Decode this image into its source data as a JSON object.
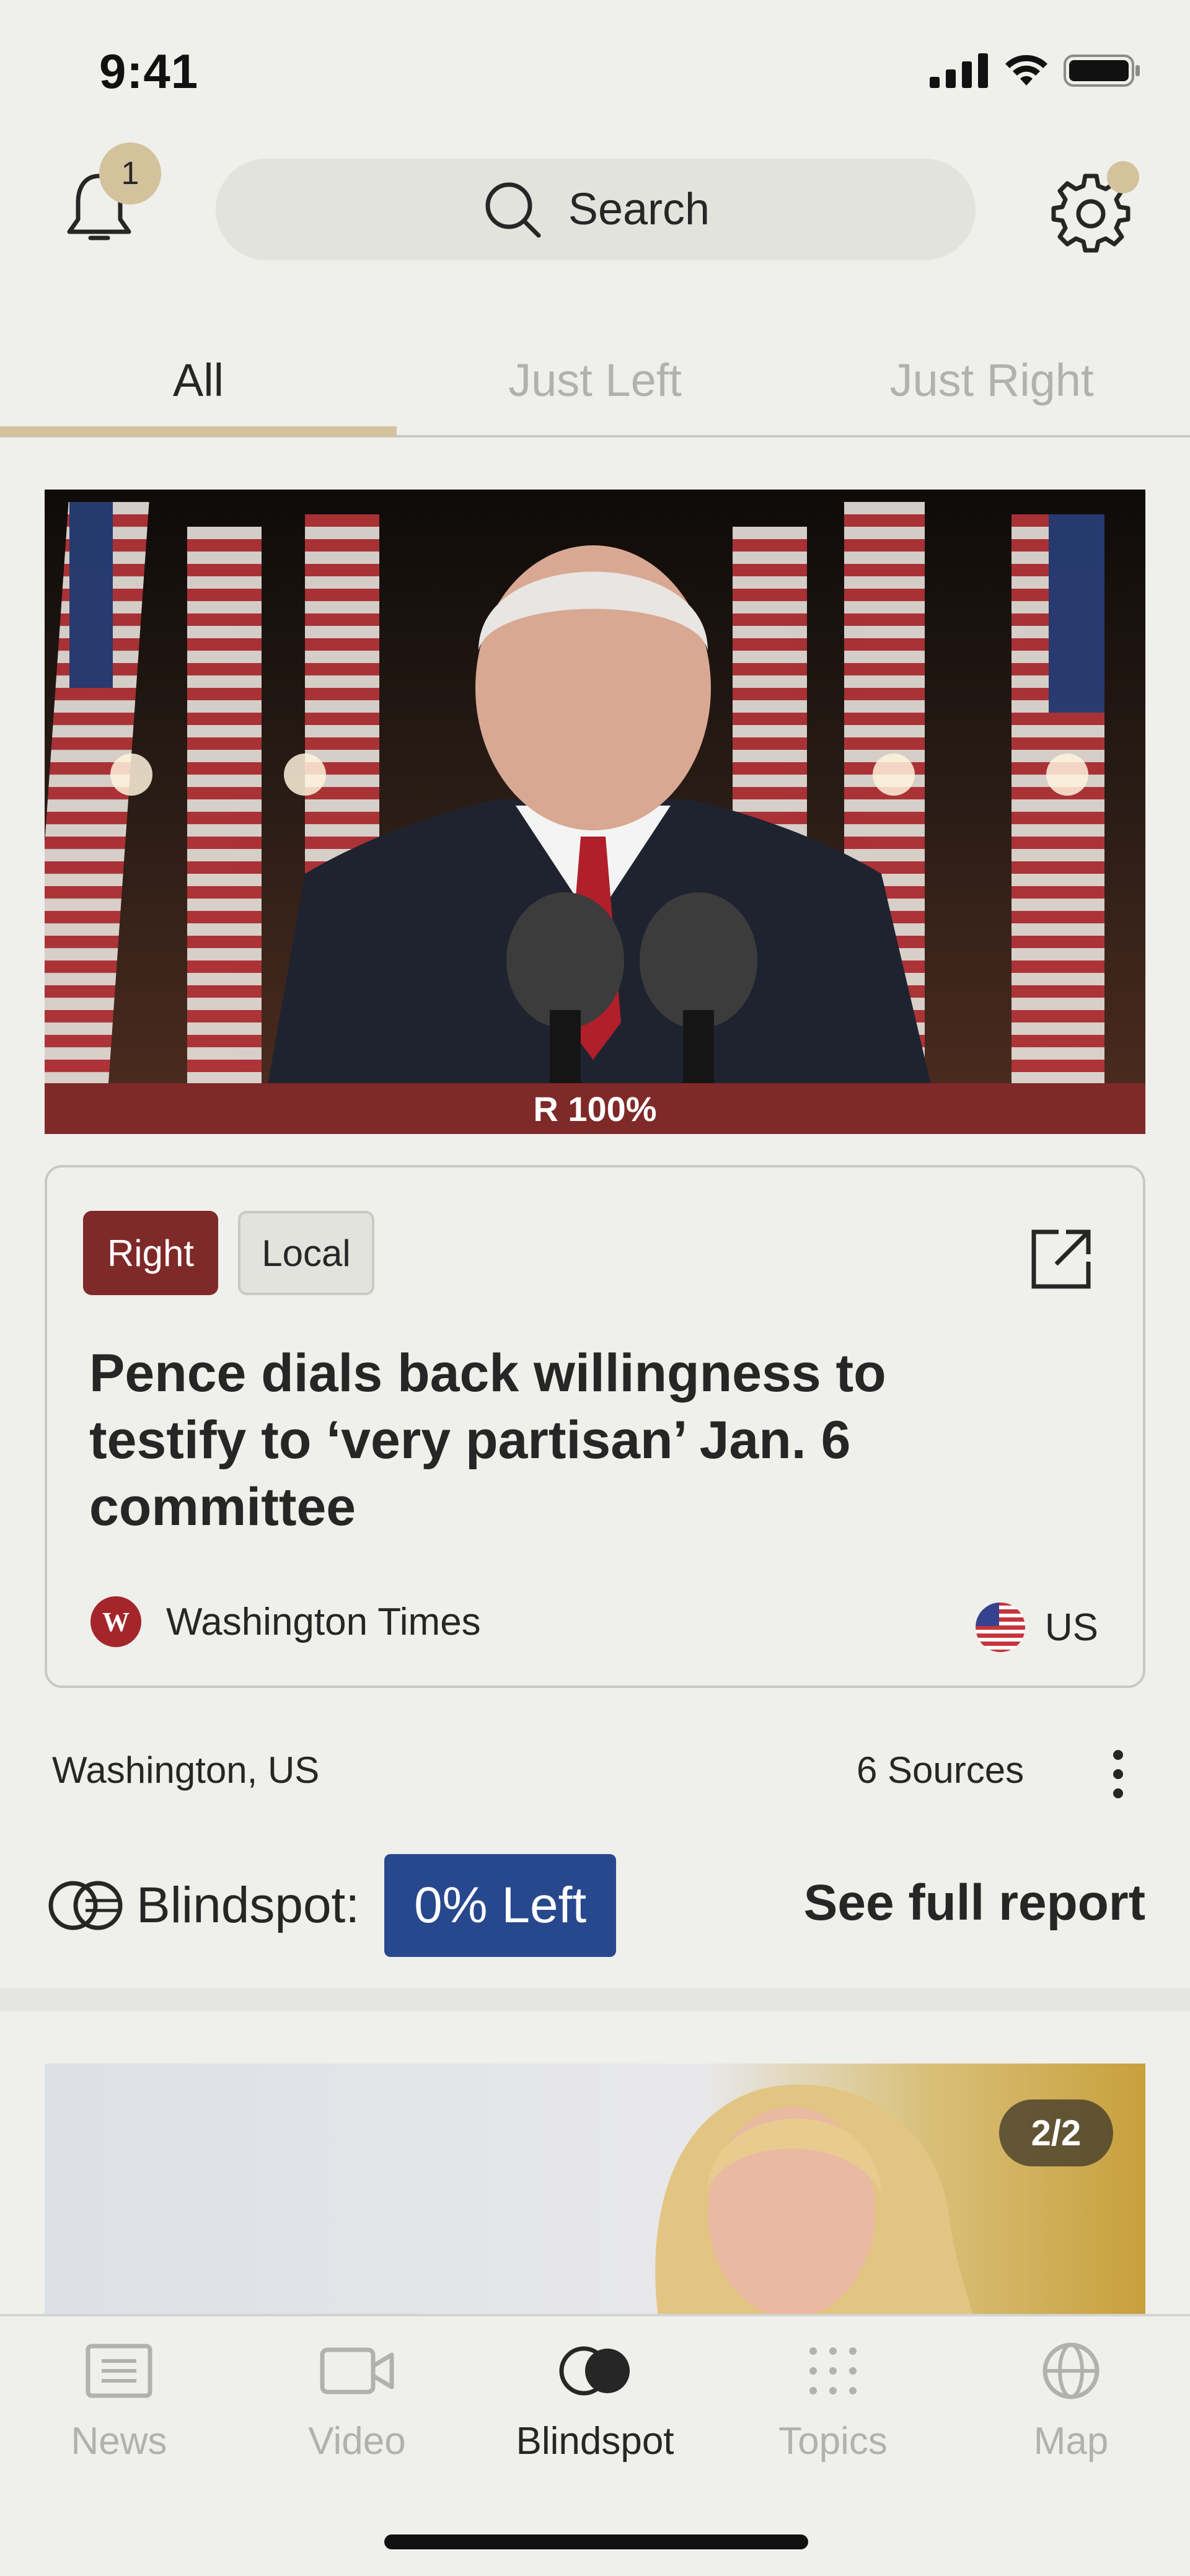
{
  "status_bar": {
    "time": "9:41"
  },
  "header": {
    "notification_count": "1",
    "search_label": "Search"
  },
  "tabs": [
    {
      "label": "All",
      "active": true
    },
    {
      "label": "Just Left",
      "active": false
    },
    {
      "label": "Just Right",
      "active": false
    }
  ],
  "story": {
    "bias_label": "R 100%",
    "tags": [
      "Right",
      "Local"
    ],
    "headline": "Pence dials back willingness to testify to ‘very partisan’ Jan. 6 committee",
    "source_name": "Washington Times",
    "country": "US",
    "location": "Washington, US",
    "sources_count": "6 Sources",
    "blindspot_label": "Blindspot:",
    "blindspot_value": "0% Left",
    "full_report_label": "See full report",
    "colors": {
      "right": "#7f2929",
      "left": "#28488e",
      "accent": "#d4c29c"
    }
  },
  "story2": {
    "image_counter": "2/2"
  },
  "bottom_nav": [
    {
      "label": "News",
      "icon": "news-icon",
      "active": false
    },
    {
      "label": "Video",
      "icon": "video-icon",
      "active": false
    },
    {
      "label": "Blindspot",
      "icon": "blindspot-icon",
      "active": true
    },
    {
      "label": "Topics",
      "icon": "topics-grid-icon",
      "active": false
    },
    {
      "label": "Map",
      "icon": "globe-icon",
      "active": false
    }
  ]
}
